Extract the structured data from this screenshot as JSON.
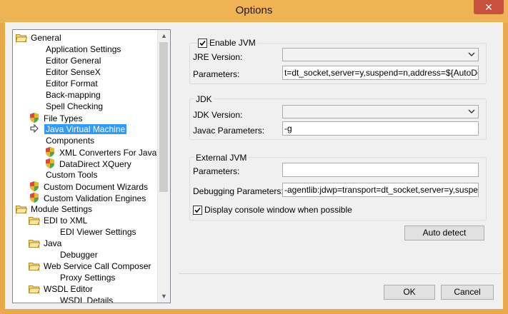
{
  "window": {
    "title": "Options",
    "close_glyph": "✕"
  },
  "tree": {
    "items": [
      {
        "label": "General",
        "icon": "folder-open-icon"
      },
      {
        "label": "Application Settings",
        "icon": ""
      },
      {
        "label": "Editor General",
        "icon": ""
      },
      {
        "label": "Editor SenseX",
        "icon": ""
      },
      {
        "label": "Editor Format",
        "icon": ""
      },
      {
        "label": "Back-mapping",
        "icon": ""
      },
      {
        "label": "Spell Checking",
        "icon": ""
      },
      {
        "label": "File Types",
        "icon": "shield-icon"
      },
      {
        "label": "Java Virtual Machine",
        "icon": "arrow-icon",
        "selected": true
      },
      {
        "label": "Components",
        "icon": ""
      },
      {
        "label": "XML Converters For Java",
        "icon": "shield-icon"
      },
      {
        "label": "DataDirect XQuery",
        "icon": "shield-icon"
      },
      {
        "label": "Custom Tools",
        "icon": ""
      },
      {
        "label": "Custom Document Wizards",
        "icon": "shield-icon"
      },
      {
        "label": "Custom Validation Engines",
        "icon": "shield-icon"
      },
      {
        "label": "Module Settings",
        "icon": "folder-open-icon"
      },
      {
        "label": "EDI to XML",
        "icon": "folder-open-icon"
      },
      {
        "label": "EDI Viewer Settings",
        "icon": ""
      },
      {
        "label": "Java",
        "icon": "folder-open-icon"
      },
      {
        "label": "Debugger",
        "icon": ""
      },
      {
        "label": "Web Service Call Composer",
        "icon": "folder-open-icon"
      },
      {
        "label": "Proxy Settings",
        "icon": ""
      },
      {
        "label": "WSDL Editor",
        "icon": "folder-open-icon"
      },
      {
        "label": "WSDL Details",
        "icon": ""
      }
    ]
  },
  "jvm": {
    "enable_label": "Enable JVM",
    "enable_checked": true,
    "jre_version_label": "JRE Version:",
    "jre_version_value": "",
    "parameters_label": "Parameters:",
    "parameters_value": "t=dt_socket,server=y,suspend=n,address=${AutoDetect}"
  },
  "jdk": {
    "group_label": "JDK",
    "version_label": "JDK Version:",
    "version_value": "",
    "javac_label": "Javac Parameters:",
    "javac_value": "-g"
  },
  "external": {
    "group_label": "External JVM",
    "parameters_label": "Parameters:",
    "parameters_value": "",
    "debug_label": "Debugging Parameters:",
    "debug_value": "-agentlib:jdwp=transport=dt_socket,server=y,suspend=y,a",
    "console_label": "Display console window when possible",
    "console_checked": true
  },
  "buttons": {
    "auto_detect": "Auto detect",
    "ok": "OK",
    "cancel": "Cancel"
  },
  "colors": {
    "selection": "#3399ff",
    "title_bar": "#f0b354",
    "close": "#c7503f"
  }
}
